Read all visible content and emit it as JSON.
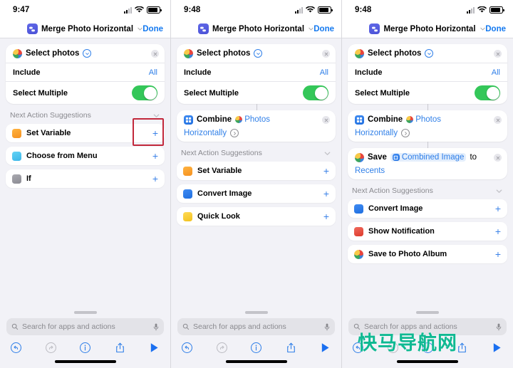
{
  "phones": [
    {
      "id": "phone-1",
      "status": {
        "time": "9:47",
        "signal_icon": "cellular-bars-icon",
        "wifi_icon": "wifi-icon",
        "battery_icon": "battery-icon"
      },
      "nav": {
        "app_icon": "shortcuts-icon",
        "title": "Merge Photo Horizontal",
        "chevron_icon": "chevron-down-icon",
        "done_label": "Done"
      },
      "actions": [
        {
          "icon": "photos-icon",
          "title": "Select photos",
          "trailing_glyph": "chevron-down-circle-icon",
          "close_icon": "close-icon",
          "rows": [
            {
              "label": "Include",
              "value": "All",
              "type": "value"
            },
            {
              "label": "Select Multiple",
              "value": "on",
              "type": "toggle",
              "highlighted": true
            }
          ]
        }
      ],
      "suggestions": {
        "header": "Next Action Suggestions",
        "chevron_icon": "chevron-down-icon",
        "items": [
          {
            "label": "Set Variable",
            "icon": "variable-icon",
            "color": "s-orange",
            "add_icon": "plus-icon"
          },
          {
            "label": "Choose from Menu",
            "icon": "menu-icon",
            "color": "s-cyan",
            "add_icon": "plus-icon"
          },
          {
            "label": "If",
            "icon": "if-icon",
            "color": "s-gray",
            "add_icon": "plus-icon"
          }
        ]
      },
      "bottom": {
        "search_placeholder": "Search for apps and actions",
        "search_icon": "search-icon",
        "mic_icon": "microphone-icon",
        "toolbar": [
          {
            "name": "undo-button",
            "icon": "undo-icon",
            "enabled": true
          },
          {
            "name": "redo-button",
            "icon": "redo-icon",
            "enabled": false
          },
          {
            "name": "info-button",
            "icon": "info-icon",
            "enabled": true
          },
          {
            "name": "share-button",
            "icon": "share-icon",
            "enabled": true
          },
          {
            "name": "play-button",
            "icon": "play-icon",
            "enabled": true
          }
        ]
      },
      "watermark": ""
    },
    {
      "id": "phone-2",
      "status": {
        "time": "9:48",
        "signal_icon": "cellular-bars-icon",
        "wifi_icon": "wifi-icon",
        "battery_icon": "battery-icon"
      },
      "nav": {
        "app_icon": "shortcuts-icon",
        "title": "Merge Photo Horizontal",
        "chevron_icon": "chevron-down-icon",
        "done_label": "Done"
      },
      "actions": [
        {
          "icon": "photos-icon",
          "title": "Select photos",
          "trailing_glyph": "chevron-down-circle-icon",
          "close_icon": "close-icon",
          "rows": [
            {
              "label": "Include",
              "value": "All",
              "type": "value"
            },
            {
              "label": "Select Multiple",
              "value": "on",
              "type": "toggle",
              "highlighted": false
            }
          ]
        },
        {
          "icon": "combine-icon",
          "title": "Combine",
          "token": "Photos",
          "token_icon": "photos-icon",
          "param": "Horizontally",
          "param_glyph": "chevron-right-circle-icon",
          "close_icon": "close-icon",
          "rows": []
        }
      ],
      "suggestions": {
        "header": "Next Action Suggestions",
        "chevron_icon": "chevron-down-icon",
        "items": [
          {
            "label": "Set Variable",
            "icon": "variable-icon",
            "color": "s-orange",
            "add_icon": "plus-icon"
          },
          {
            "label": "Convert Image",
            "icon": "image-icon",
            "color": "s-blue",
            "add_icon": "plus-icon"
          },
          {
            "label": "Quick Look",
            "icon": "eye-icon",
            "color": "s-yellow",
            "add_icon": "plus-icon"
          }
        ]
      },
      "bottom": {
        "search_placeholder": "Search for apps and actions",
        "search_icon": "search-icon",
        "mic_icon": "microphone-icon",
        "toolbar": [
          {
            "name": "undo-button",
            "icon": "undo-icon",
            "enabled": true
          },
          {
            "name": "redo-button",
            "icon": "redo-icon",
            "enabled": false
          },
          {
            "name": "info-button",
            "icon": "info-icon",
            "enabled": true
          },
          {
            "name": "share-button",
            "icon": "share-icon",
            "enabled": true
          },
          {
            "name": "play-button",
            "icon": "play-icon",
            "enabled": true
          }
        ]
      },
      "watermark": ""
    },
    {
      "id": "phone-3",
      "status": {
        "time": "9:48",
        "signal_icon": "cellular-bars-icon",
        "wifi_icon": "wifi-icon",
        "battery_icon": "battery-icon"
      },
      "nav": {
        "app_icon": "shortcuts-icon",
        "title": "Merge Photo Horizontal",
        "chevron_icon": "chevron-down-icon",
        "done_label": "Done"
      },
      "actions": [
        {
          "icon": "photos-icon",
          "title": "Select photos",
          "trailing_glyph": "chevron-down-circle-icon",
          "close_icon": "close-icon",
          "rows": [
            {
              "label": "Include",
              "value": "All",
              "type": "value"
            },
            {
              "label": "Select Multiple",
              "value": "on",
              "type": "toggle",
              "highlighted": false
            }
          ]
        },
        {
          "icon": "combine-icon",
          "title": "Combine",
          "token": "Photos",
          "token_icon": "photos-icon",
          "param": "Horizontally",
          "param_glyph": "chevron-right-circle-icon",
          "close_icon": "close-icon",
          "rows": []
        },
        {
          "icon": "photos-icon",
          "title": "Save",
          "token": "Combined Image",
          "token_icon": "image-token-icon",
          "suffix": "to",
          "param": "Recents",
          "close_icon": "close-icon",
          "rows": []
        }
      ],
      "suggestions": {
        "header": "Next Action Suggestions",
        "chevron_icon": "chevron-down-icon",
        "items": [
          {
            "label": "Convert Image",
            "icon": "image-icon",
            "color": "s-blue",
            "add_icon": "plus-icon"
          },
          {
            "label": "Show Notification",
            "icon": "notification-icon",
            "color": "s-red",
            "add_icon": "plus-icon"
          },
          {
            "label": "Save to Photo Album",
            "icon": "photos-icon",
            "color": "s-photos",
            "add_icon": "plus-icon"
          }
        ]
      },
      "bottom": {
        "search_placeholder": "Search for apps and actions",
        "search_icon": "search-icon",
        "mic_icon": "microphone-icon",
        "toolbar": [
          {
            "name": "undo-button",
            "icon": "undo-icon",
            "enabled": true
          },
          {
            "name": "redo-button",
            "icon": "redo-icon",
            "enabled": false
          },
          {
            "name": "info-button",
            "icon": "info-icon",
            "enabled": true
          },
          {
            "name": "share-button",
            "icon": "share-icon",
            "enabled": true
          },
          {
            "name": "play-button",
            "icon": "play-icon",
            "enabled": true
          }
        ]
      },
      "watermark": "快马导航网"
    }
  ],
  "colors": {
    "accent_blue": "#2f7fe8",
    "toggle_green": "#34c759",
    "highlight_red": "#c2283b",
    "watermark_green": "#0fb992",
    "background": "#f2f2f7"
  }
}
